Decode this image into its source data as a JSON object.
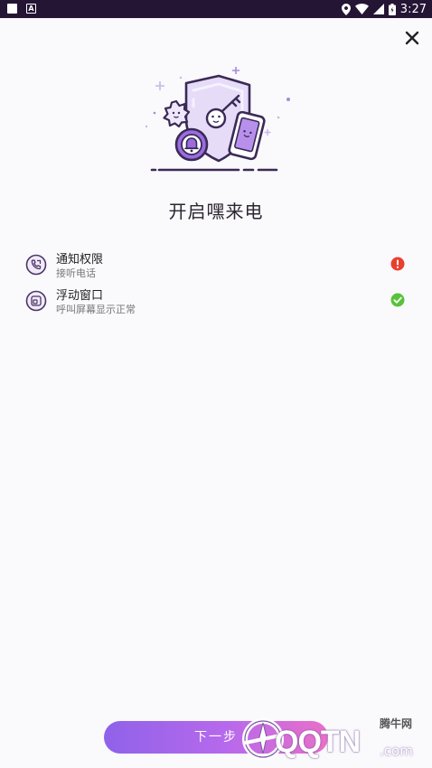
{
  "status_bar": {
    "a_icon_label": "A",
    "time": "3:27"
  },
  "page": {
    "title": "开启嘿来电",
    "close_symbol": "✕"
  },
  "permissions": [
    {
      "name": "通知权限",
      "description": "接听电话",
      "icon": "phone-icon",
      "status": "error",
      "status_color": "#e8402e"
    },
    {
      "name": "浮动窗口",
      "description": "呼叫屏幕显示正常",
      "icon": "floating-window-icon",
      "status": "ok",
      "status_color": "#58c23a"
    }
  ],
  "next_button": {
    "label": "下一步"
  },
  "watermark": {
    "brand": "QQTN",
    "suffix": ".com",
    "top_text": "腾牛网"
  },
  "colors": {
    "accent": "#7b4fc7",
    "statusbar": "#241535"
  }
}
